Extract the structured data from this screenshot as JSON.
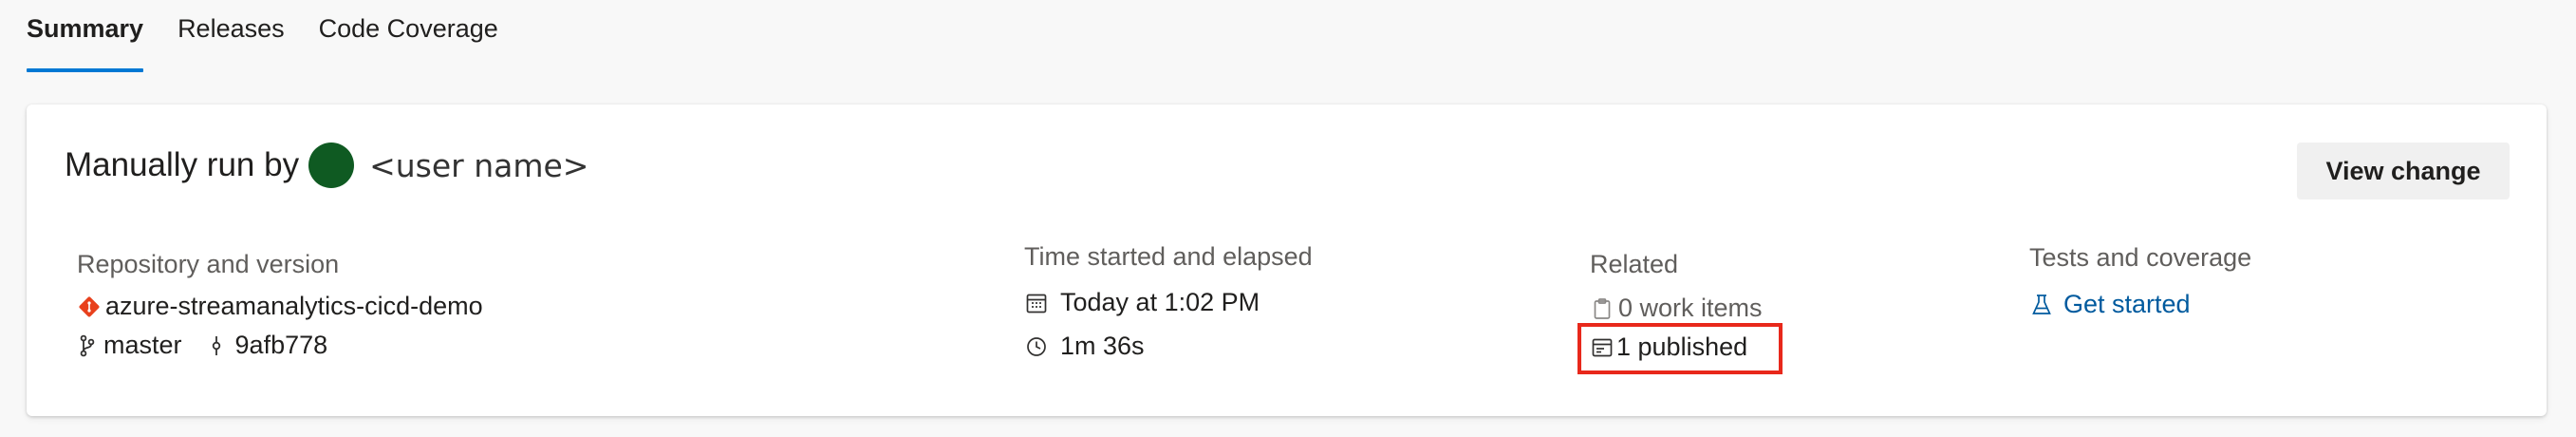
{
  "tabs": [
    {
      "label": "Summary",
      "active": true
    },
    {
      "label": "Releases",
      "active": false
    },
    {
      "label": "Code Coverage",
      "active": false
    }
  ],
  "summary": {
    "run_by_label": "Manually run by",
    "user_name": "<user name>",
    "view_change_label": "View change"
  },
  "repository": {
    "label": "Repository and version",
    "name": "azure-streamanalytics-cicd-demo",
    "branch": "master",
    "commit": "9afb778"
  },
  "time": {
    "label": "Time started and elapsed",
    "started": "Today at 1:02 PM",
    "elapsed": "1m 36s"
  },
  "related": {
    "label": "Related",
    "work_items": "0 work items",
    "published": "1 published"
  },
  "tests": {
    "label": "Tests and coverage",
    "link": "Get started"
  },
  "colors": {
    "accent": "#0078d4",
    "link": "#005a9e",
    "git_icon": "#e8401c",
    "avatar": "#0f5a22",
    "highlight_border": "#e8281b"
  },
  "icons": [
    "git-repo-icon",
    "branch-icon",
    "commit-icon",
    "calendar-icon",
    "clock-icon",
    "clipboard-icon",
    "artifact-icon",
    "beaker-icon"
  ]
}
